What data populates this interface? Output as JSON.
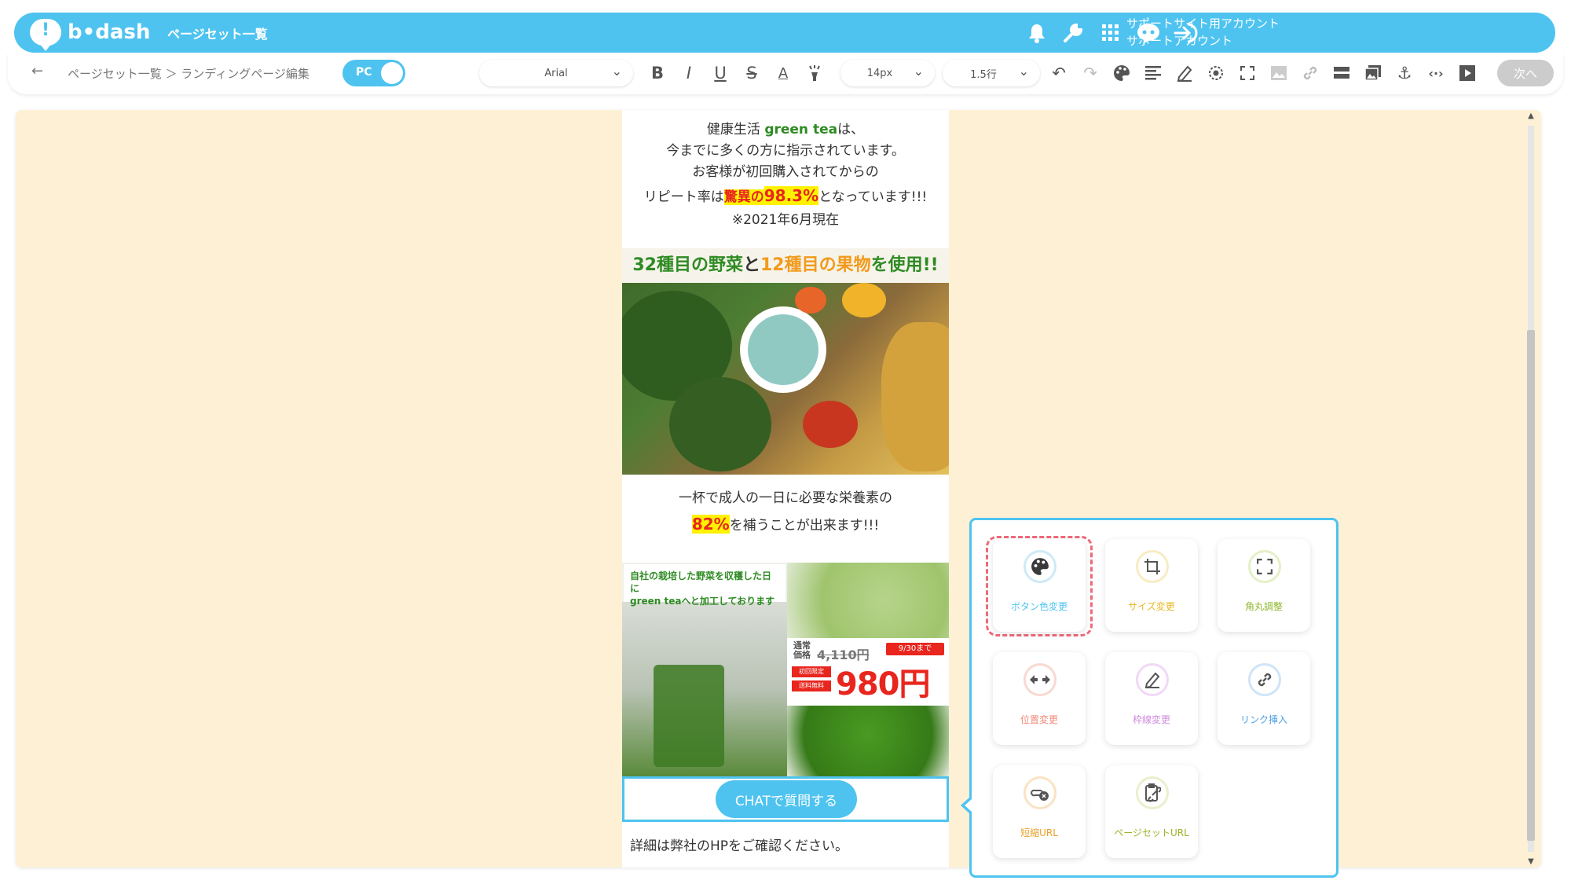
{
  "header": {
    "logo_text": "b•dash",
    "logo_mark": "!",
    "nav_label": "ページセット一覧",
    "account_line1": "サポートサイト用アカウント",
    "account_line2": "サポートアカウント",
    "icons": [
      "bell-icon",
      "wrench-icon",
      "grid-icon",
      "chat-robot-icon",
      "logout-icon"
    ]
  },
  "toolbar": {
    "breadcrumb": "ページセット一覧 ＞ ランディングページ編集",
    "device_toggle": "PC",
    "font_family": "Arial",
    "font_size": "14px",
    "line_height": "1.5行",
    "format_buttons": [
      "B",
      "I",
      "U",
      "S",
      "A"
    ],
    "next_label": "次へ"
  },
  "lp": {
    "intro": {
      "line1_prefix": "健康生活 ",
      "line1_brand": "green tea",
      "line1_suffix": "は、",
      "line2": "今までに多くの方に指示されています。",
      "line3": "お客様が初回購入されてからの",
      "line4_prefix": "リピート率は",
      "line4_highlight_a": "驚異の",
      "line4_highlight_b": "98.3%",
      "line4_suffix": "となっています!!!",
      "line5": "※2021年6月現在"
    },
    "banner1": {
      "part1": "32種目の野菜",
      "part2": "と",
      "part3": "12種目の果物",
      "part4": "を使用!!"
    },
    "nutrition": {
      "line1": "一杯で成人の一日に必要な栄養素の",
      "line2_highlight": "82%",
      "line2_suffix": "を補うことが出来ます!!!"
    },
    "banner2": {
      "caption_line1": "自社の栽培した野菜を収穫した日に",
      "caption_line2": "green teaへと加工しております",
      "regular_label": "通常価格",
      "old_price": "4,110円",
      "deadline": "9/30まで",
      "tag1": "初回限定",
      "tag2": "送料無料",
      "new_price": "980円"
    },
    "chat_button": "CHATで質問する",
    "detail_text": "詳細は弊社のHPをご確認ください。"
  },
  "popover": {
    "tools": [
      {
        "label": "ボタン色変更",
        "icon": "palette-icon",
        "color": "#4ec3f0"
      },
      {
        "label": "サイズ変更",
        "icon": "crop-icon",
        "color": "#f2c744"
      },
      {
        "label": "角丸調整",
        "icon": "corner-icon",
        "color": "#a4cc3d"
      },
      {
        "label": "位置変更",
        "icon": "move-arrows-icon",
        "color": "#f08a7a"
      },
      {
        "label": "枠線変更",
        "icon": "pen-border-icon",
        "color": "#d08ae0"
      },
      {
        "label": "リンク挿入",
        "icon": "link-icon",
        "color": "#4ea0e0"
      },
      {
        "label": "短縮URL",
        "icon": "short-url-icon",
        "color": "#f2a93b"
      },
      {
        "label": "ページセットURL",
        "icon": "clipboard-link-icon",
        "color": "#b0c23b"
      }
    ],
    "selected_tool": "ボタン色変更"
  }
}
